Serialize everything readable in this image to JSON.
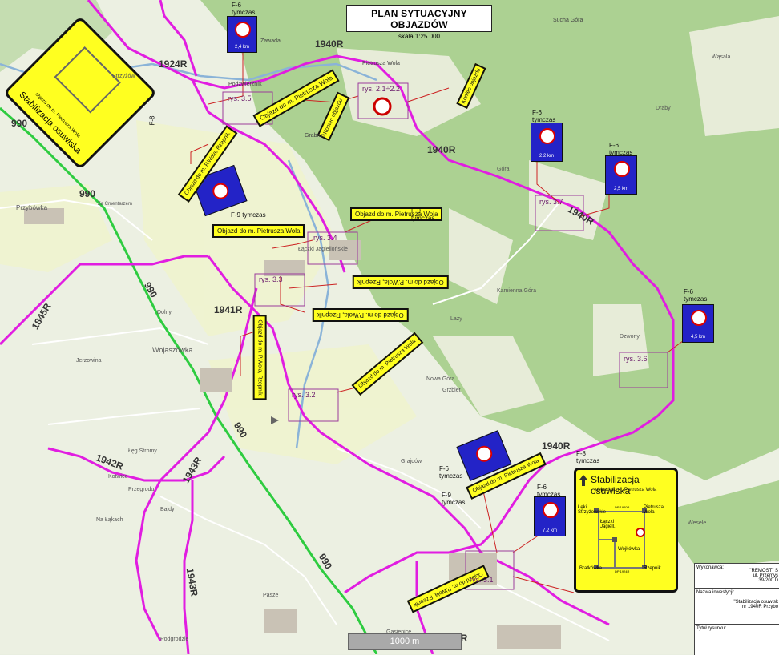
{
  "title": {
    "main": "PLAN SYTUACYJNY OBJAZDÓW",
    "scale": "skala 1:25 000"
  },
  "scalebar": {
    "label": "1000 m"
  },
  "road_labels": [
    "1924R",
    "1940R",
    "1940R",
    "1940R",
    "1940R",
    "1941R",
    "1942R",
    "1943R",
    "1943R",
    "1944R",
    "1845R",
    "990",
    "990",
    "990",
    "990",
    "990"
  ],
  "place_labels": [
    "Zawada",
    "Pietrusza Wola",
    "Sucha Góra",
    "Podzwierzník",
    "Grabnin",
    "Wojaszówka",
    "Przybówka",
    "Łączki Jagiellońskie",
    "Kamienna Góra",
    "Dzwony",
    "Gąsienice",
    "Góra",
    "Draby",
    "Wąsala",
    "Nowa Góra",
    "Bajdy",
    "Pasze",
    "Lazy",
    "Kotwice",
    "Przegrodu",
    "Na Łąkach",
    "Łęg Stromy",
    "Za Cmentarzem",
    "Dolny",
    "Grajdów",
    "Grzbiet",
    "Podgrodzie",
    "Wesele",
    "Jerzowina",
    "Strzyżów"
  ],
  "rys_labels": [
    "rys. 3.5",
    "rys. 2.1÷2.2",
    "rys. 3.4",
    "rys. 3.3",
    "rys. 3.7",
    "rys. 3.6",
    "rys. 3.2",
    "rys. 3.1"
  ],
  "signs": {
    "f6_label": "F-6",
    "tymczas": "tymczas",
    "f9_label": "F-9",
    "f9_tymczas": "F-9\ntymczas",
    "f8_tymczas": "F-8\ntymczas",
    "km_24": "2,4 km",
    "km_22": "2,2 km",
    "km_25": "2,5 km",
    "km_45": "4,5 km",
    "km_72": "7,2 km",
    "objazd_pietrusza": "Objazd do m. Pietrusza Wola",
    "objazd_pwola_rzepnik": "Objazd do m. P.Wola, Rzepnik",
    "objazd_wola_rzepnik": "Objazd do m. P.Wola, Rzepnik",
    "koniec_objazdu": "Koniec objazdu",
    "f8_sign": "F-8"
  },
  "big_panel": {
    "title": "Stabilizacja osuwiska",
    "subtitle": "objazd do m. Pietrusza Wola",
    "towns": [
      "Łęki Strzyżowskie",
      "Pietrusza Wola",
      "Łączki Jagiell.",
      "Wojkówka",
      "Bratkówka",
      "Rzepnik"
    ],
    "roads": [
      "DP 1940R",
      "DP 1924R",
      "DP 1924R",
      "DP 1940R",
      "DP 1943R"
    ]
  },
  "rotated_panel": {
    "title": "Stabilizacja osuwiska",
    "subtitle": "objazd do m. Pietrusza Wola"
  },
  "info_panel": {
    "wykonawca_label": "Wykonawca:",
    "wykonawca_text": "\"REMOST\" S\nul. Przemys\n39-200 D",
    "inwestycja_label": "Nazwa inwestycji:",
    "inwestycja_text": "\"Stabilizacja osuwisk\nnr 1940R Przybó",
    "tytul_label": "Tytuł rysunku:"
  }
}
